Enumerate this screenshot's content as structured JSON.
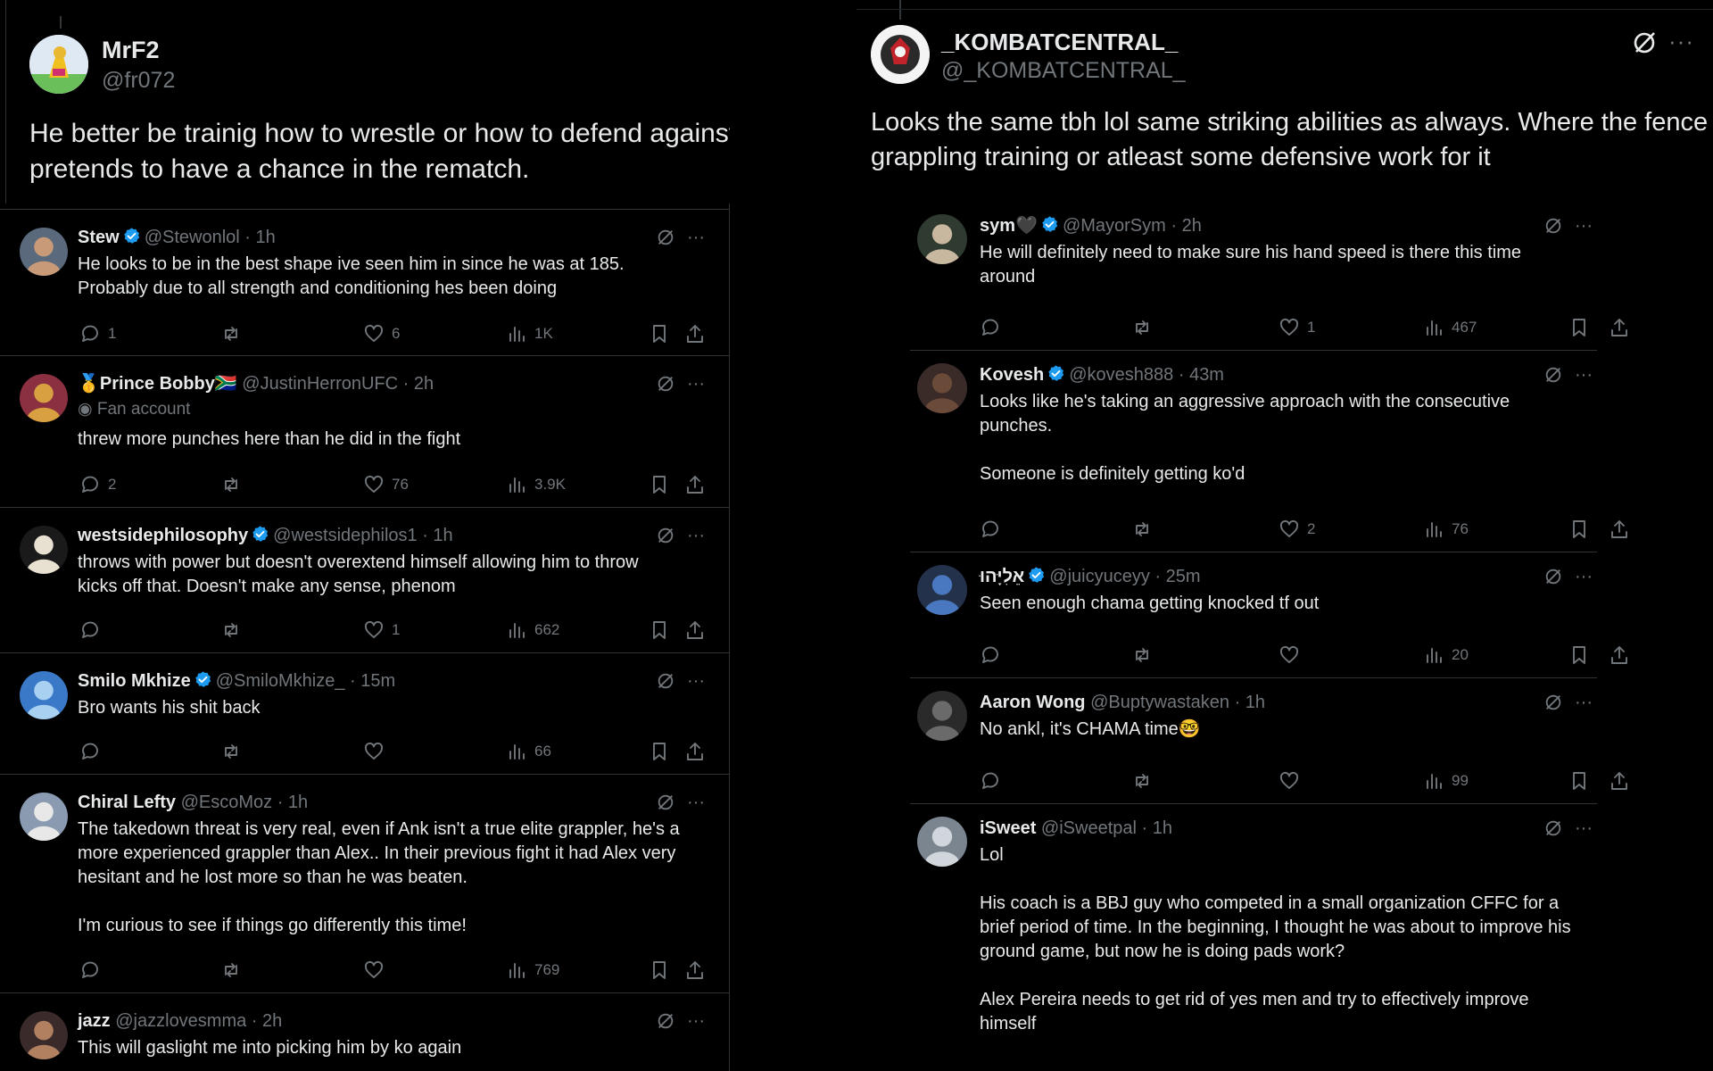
{
  "left": {
    "main": {
      "name": "MrF2",
      "handle": "@fr072",
      "text": "He better be trainig how to wrestle or how to defend against it, if he pretends to have a chance in the rematch."
    },
    "replies": [
      {
        "name": "Stew",
        "verified": true,
        "meta": "@Stewonlol · 1h",
        "text": "He looks to be in the best shape ive seen him in since he was at 185.\nProbably due to all strength and conditioning hes been doing",
        "replies": "1",
        "likes": "6",
        "views": "1K"
      },
      {
        "name": "🥇Prince Bobby🇿🇦",
        "verified": false,
        "meta": "@JustinHerronUFC · 2h",
        "fan": "Fan account",
        "text": "threw more punches here than he did in the fight",
        "replies": "2",
        "likes": "76",
        "views": "3.9K"
      },
      {
        "name": "westsidephilosophy",
        "verified": true,
        "meta": "@westsidephilos1 · 1h",
        "text": "throws with power but doesn't overextend himself allowing him to throw\nkicks off that. Doesn't make any sense, phenom",
        "replies": "",
        "likes": "1",
        "views": "662"
      },
      {
        "name": "Smilo Mkhize",
        "verified": true,
        "meta": "@SmiloMkhize_ · 15m",
        "text": "Bro wants his shit back",
        "replies": "",
        "likes": "",
        "views": "66"
      },
      {
        "name": "Chiral Lefty",
        "verified": false,
        "meta": "@EscoMoz · 1h",
        "text": "The takedown threat is very real, even if Ank isn't a true elite grappler, he's a\nmore experienced grappler than Alex.. In their previous fight it had Alex very\nhesitant and he lost more so than he was beaten.\n\nI'm curious to see if things go differently this time!",
        "replies": "",
        "likes": "",
        "views": "769"
      },
      {
        "name": "jazz",
        "verified": false,
        "meta": "@jazzlovesmma · 2h",
        "text": "This will gaslight me into picking him by ko again"
      }
    ]
  },
  "right": {
    "main": {
      "name": "_KOMBATCENTRAL_",
      "handle": "@_KOMBATCENTRAL_",
      "text": "Looks the same tbh lol same striking abilities as always. Where the fence grappling training or atleast some defensive work for it"
    },
    "replies": [
      {
        "name": "sym🖤",
        "verified": true,
        "meta": "@MayorSym · 2h",
        "text": "He will definitely need to make sure his hand speed is there this time\naround",
        "replies": "",
        "likes": "1",
        "views": "467"
      },
      {
        "name": "Kovesh",
        "verified": true,
        "meta": "@kovesh888 · 43m",
        "text": "Looks like he's taking an aggressive approach with the consecutive\npunches.\n\nSomeone is definitely getting ko'd",
        "replies": "",
        "likes": "2",
        "views": "76"
      },
      {
        "name": "אֵלִיָּהוּ",
        "verified": true,
        "meta": "@juicyuceyy · 25m",
        "text": "Seen enough chama getting knocked tf out",
        "replies": "",
        "likes": "",
        "views": "20"
      },
      {
        "name": "Aaron Wong",
        "verified": false,
        "meta": "@Buptywastaken · 1h",
        "text": "No ankl, it's CHAMA time🤓",
        "replies": "",
        "likes": "",
        "views": "99"
      },
      {
        "name": "iSweet",
        "verified": false,
        "meta": "@iSweetpal · 1h",
        "text": "Lol\n\nHis coach is a BBJ guy who competed in a small organization CFFC for a\nbrief period of time. In the beginning, I thought he was about to improve his\nground game, but now he is doing pads work?\n\nAlex Pereira needs to get rid of yes men and try to effectively improve\nhimself"
      }
    ]
  },
  "colors": {
    "bg": "#000000",
    "text": "#e7e9ea",
    "muted": "#71767b",
    "verified": "#1d9bf0",
    "border": "#2f3336"
  }
}
